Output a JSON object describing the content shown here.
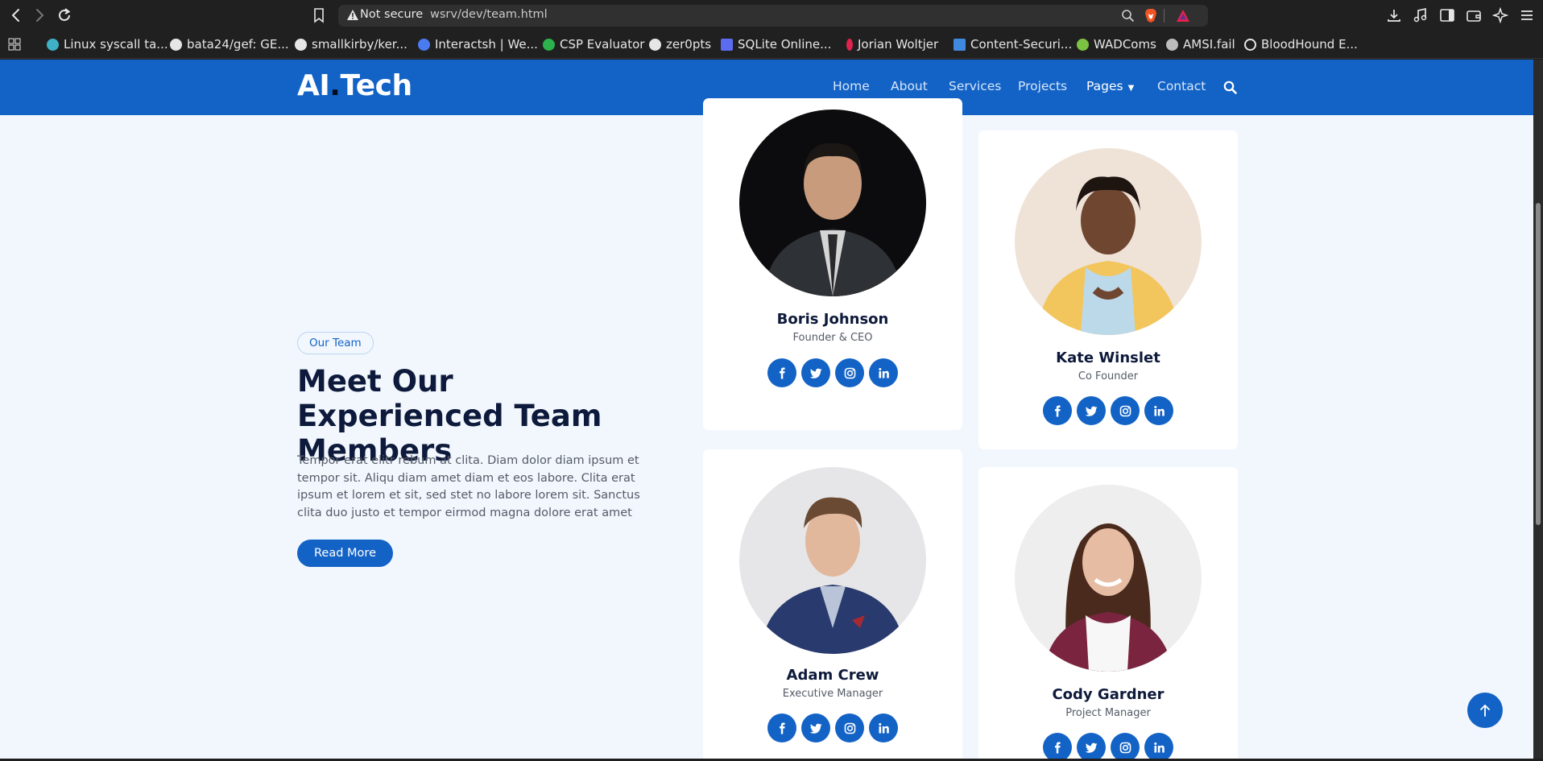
{
  "browser": {
    "security_label": "Not secure",
    "url": "wsrv/dev/team.html",
    "bookmarks": [
      "Linux syscall ta...",
      "bata24/gef: GE...",
      "smallkirby/ker...",
      "Interactsh | We...",
      "CSP Evaluator",
      "zer0pts",
      "SQLite Online...",
      "Jorian Woltjer",
      "Content-Securi...",
      "WADComs",
      "AMSI.fail",
      "BloodHound E..."
    ]
  },
  "site": {
    "logo_main": "AI",
    "logo_dot": ".",
    "logo_tail": "Tech",
    "nav": [
      "Home",
      "About",
      "Services",
      "Projects",
      "Pages",
      "Contact"
    ]
  },
  "intro": {
    "badge": "Our Team",
    "heading": "Meet Our Experienced Team Members",
    "text": "Tempor erat elitr rebum at clita. Diam dolor diam ipsum et tempor sit. Aliqu diam amet diam et eos labore. Clita erat ipsum et lorem et sit, sed stet no labore lorem sit. Sanctus clita duo justo et tempor eirmod magna dolore erat amet",
    "button": "Read More"
  },
  "team": [
    {
      "name": "Boris Johnson",
      "role": "Founder & CEO"
    },
    {
      "name": "Kate Winslet",
      "role": "Co Founder"
    },
    {
      "name": "Adam Crew",
      "role": "Executive Manager"
    },
    {
      "name": "Cody Gardner",
      "role": "Project Manager"
    }
  ],
  "colors": {
    "primary": "#1363c6",
    "page_background": "#f2f7fe",
    "heading": "#0e1a3b"
  },
  "icons": {
    "socials": [
      "facebook-icon",
      "twitter-icon",
      "instagram-icon",
      "linkedin-icon"
    ],
    "back_to_top": "arrow-up-icon"
  }
}
